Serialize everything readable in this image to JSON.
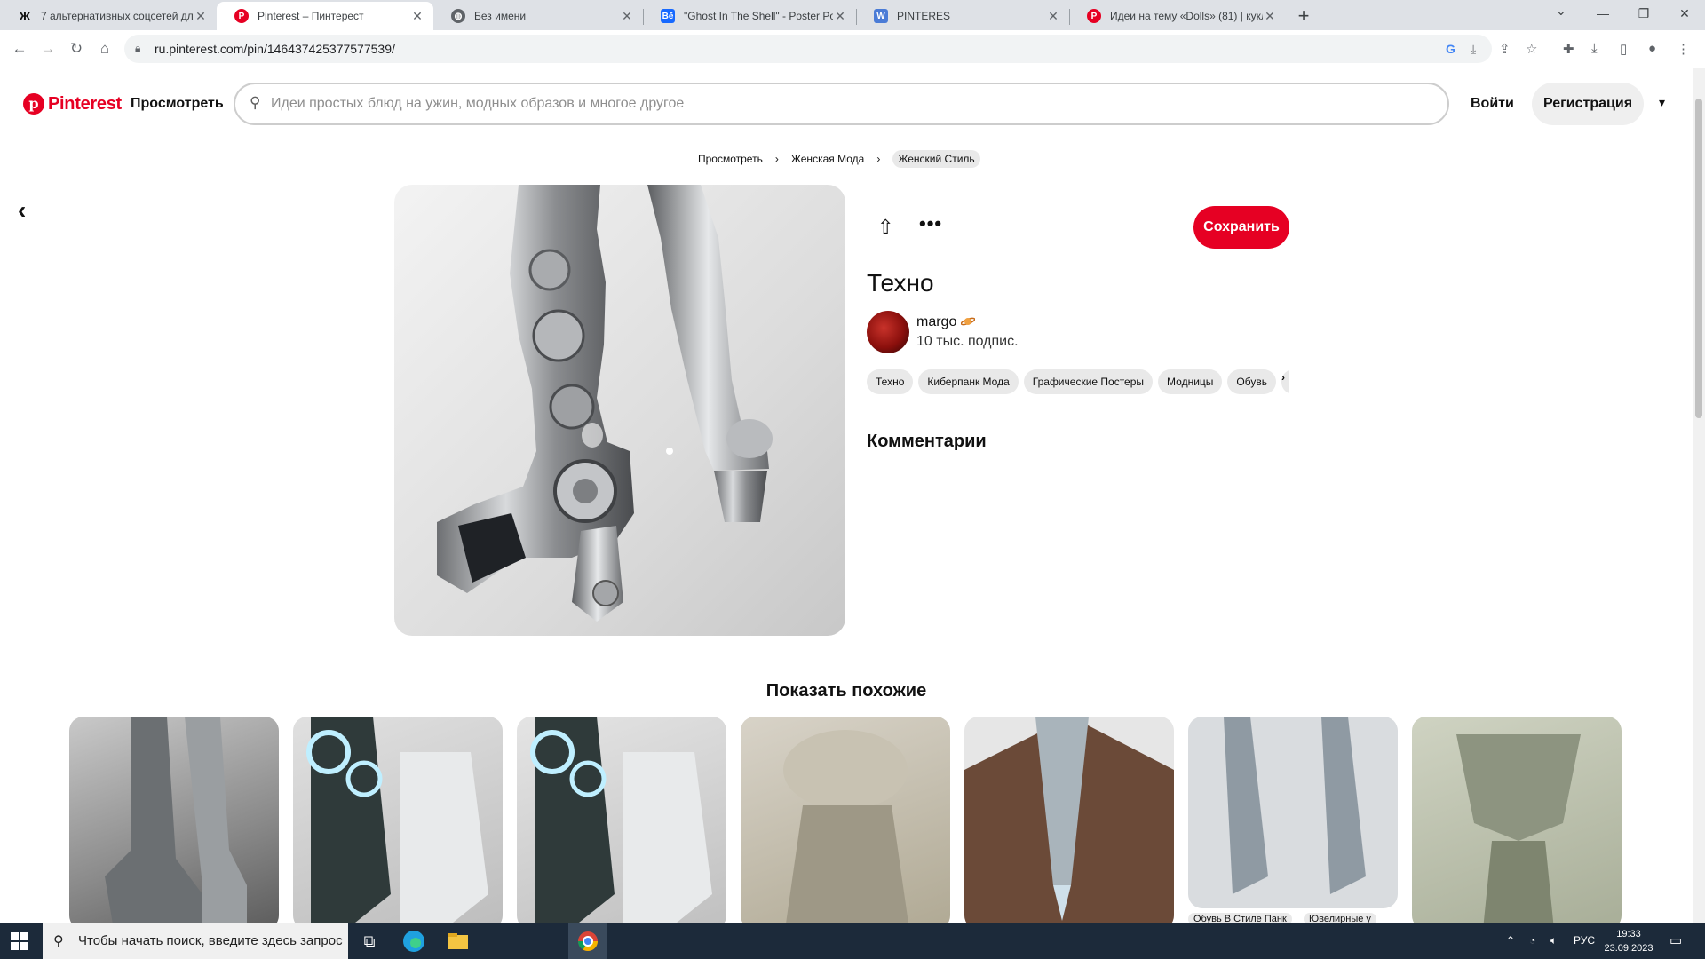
{
  "browser": {
    "tabs": [
      {
        "title": "7 альтернативных соцсетей для",
        "favicon": "pinterest-alt-icon",
        "active": false
      },
      {
        "title": "Pinterest – Пинтерест",
        "favicon": "pinterest-icon",
        "active": true
      },
      {
        "title": "Без имени",
        "favicon": "globe-icon",
        "active": false
      },
      {
        "title": "\"Ghost In The Shell\" - Poster Pos",
        "favicon": "behance-icon",
        "active": false
      },
      {
        "title": "PINTERES",
        "favicon": "docs-icon",
        "active": false
      },
      {
        "title": "Идеи на тему «Dolls» (81) | кукл",
        "favicon": "pinterest-icon",
        "active": false
      }
    ],
    "url": "ru.pinterest.com/pin/146437425377577539/"
  },
  "header": {
    "logo_text": "Pinterest",
    "browse_label": "Просмотреть",
    "search_placeholder": "Идеи простых блюд на ужин, модных образов и многое другое",
    "login_label": "Войти",
    "register_label": "Регистрация"
  },
  "breadcrumb": [
    "Просмотреть",
    "Женская Мода",
    "Женский Стиль"
  ],
  "pin": {
    "save_label": "Сохранить",
    "title": "Техно",
    "author_name": "margo",
    "author_followers": "10 тыс. подпис.",
    "tags": [
      "Техно",
      "Киберпанк Мода",
      "Графические Постеры",
      "Модницы",
      "Обувь",
      "Т"
    ],
    "comments_label": "Комментарии"
  },
  "similar": {
    "title": "Показать похожие",
    "card_labels": [
      "Обувь В Стиле Панк",
      "Ювелирные у"
    ]
  },
  "taskbar": {
    "search_text": "Чтобы начать поиск, введите здесь запрос",
    "lang": "РУС",
    "time": "19:33",
    "date": "23.09.2023"
  },
  "colors": {
    "pinterest_red": "#e60023",
    "taskbar": "#1c2a3a"
  }
}
